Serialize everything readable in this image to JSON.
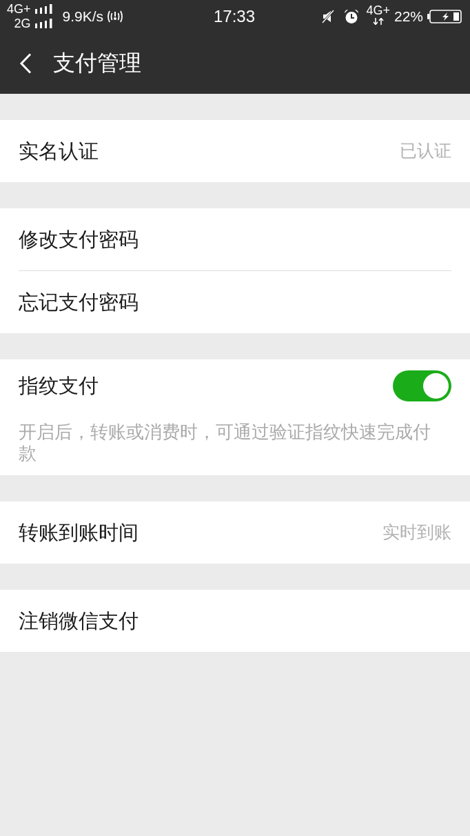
{
  "status_bar": {
    "network_top": "4G+",
    "network_bottom": "2G",
    "speed": "9.9K/s",
    "time": "17:33",
    "data_network": "4G+",
    "battery": "22%"
  },
  "header": {
    "title": "支付管理"
  },
  "groups": [
    {
      "items": [
        {
          "kind": "value",
          "label": "实名认证",
          "value": "已认证"
        }
      ]
    },
    {
      "items": [
        {
          "kind": "link",
          "label": "修改支付密码"
        },
        {
          "kind": "link",
          "label": "忘记支付密码"
        }
      ]
    },
    {
      "items": [
        {
          "kind": "toggle",
          "label": "指纹支付",
          "on": true,
          "description": "开启后，转账或消费时，可通过验证指纹快速完成付款"
        }
      ]
    },
    {
      "items": [
        {
          "kind": "value",
          "label": "转账到账时间",
          "value": "实时到账"
        }
      ]
    },
    {
      "items": [
        {
          "kind": "link",
          "label": "注销微信支付"
        }
      ]
    }
  ]
}
